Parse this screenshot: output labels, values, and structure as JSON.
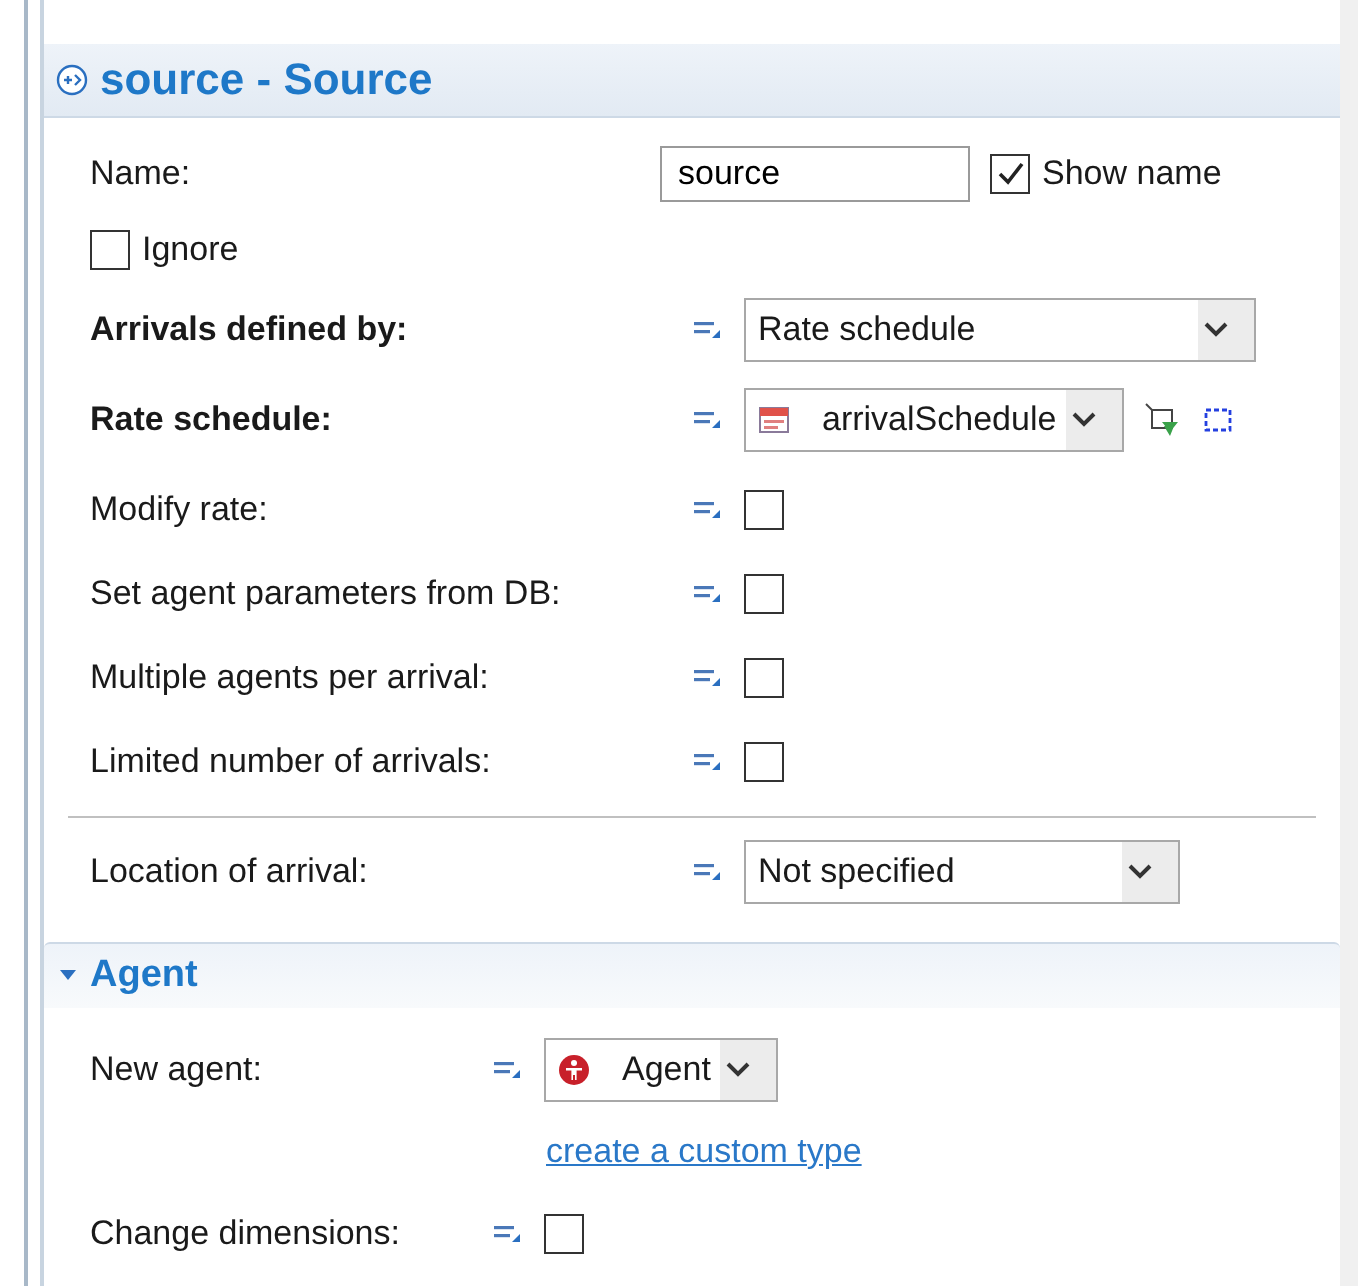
{
  "title": "source - Source",
  "name_field": {
    "label": "Name:",
    "value": "source"
  },
  "show_name": {
    "label": "Show name",
    "checked": true
  },
  "ignore": {
    "label": "Ignore",
    "checked": false
  },
  "properties": [
    {
      "label": "Arrivals defined by:",
      "bold": true,
      "kind": "select",
      "value": "Rate schedule"
    },
    {
      "label": "Rate schedule:",
      "bold": true,
      "kind": "schedule-select",
      "value": "arrivalSchedule"
    },
    {
      "label": "Modify rate:",
      "bold": false,
      "kind": "checkbox",
      "checked": false
    },
    {
      "label": "Set agent parameters from DB:",
      "bold": false,
      "kind": "checkbox",
      "checked": false
    },
    {
      "label": "Multiple agents per arrival:",
      "bold": false,
      "kind": "checkbox",
      "checked": false
    },
    {
      "label": "Limited number of arrivals:",
      "bold": false,
      "kind": "checkbox",
      "checked": false
    }
  ],
  "location": {
    "label": "Location of arrival:",
    "value": "Not specified"
  },
  "agent_section": {
    "title": "Agent",
    "expanded": true,
    "new_agent": {
      "label": "New agent:",
      "value": "Agent"
    },
    "link": "create a custom type",
    "change_dimensions": {
      "label": "Change dimensions:",
      "checked": false
    }
  }
}
